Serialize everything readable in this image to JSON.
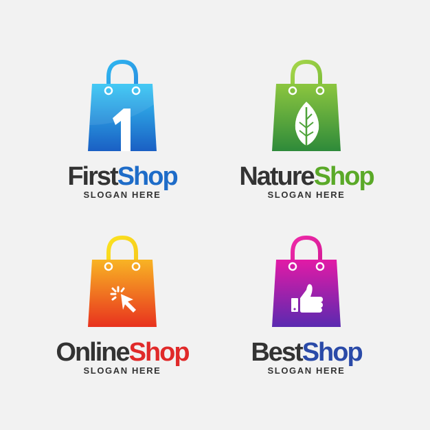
{
  "logos": [
    {
      "word1": "First",
      "word2": "Shop",
      "slogan": "SLOGAN HERE",
      "accent": "#1e6cc8",
      "icon": "number-one-icon",
      "glyph": "1"
    },
    {
      "word1": "Nature",
      "word2": "Shop",
      "slogan": "SLOGAN HERE",
      "accent": "#5aa928",
      "icon": "leaf-icon"
    },
    {
      "word1": "Online",
      "word2": "Shop",
      "slogan": "SLOGAN HERE",
      "accent": "#e02a2a",
      "icon": "cursor-click-icon"
    },
    {
      "word1": "Best",
      "word2": "Shop",
      "slogan": "SLOGAN HERE",
      "accent": "#2a4aa8",
      "icon": "thumbs-up-icon"
    }
  ]
}
